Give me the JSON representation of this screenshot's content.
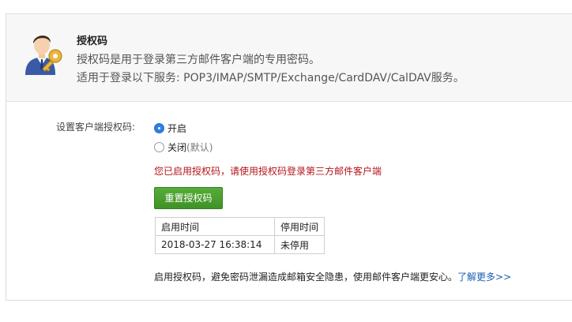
{
  "header": {
    "title": "授权码",
    "line1": "授权码是用于登录第三方邮件客户端的专用密码。",
    "line2": "适用于登录以下服务: POP3/IMAP/SMTP/Exchange/CardDAV/CalDAV服务。"
  },
  "setting": {
    "label": "设置客户端授权码:",
    "options": [
      {
        "label": "开启",
        "suffix": "",
        "checked": true
      },
      {
        "label": "关闭",
        "suffix": "(默认)",
        "checked": false
      }
    ],
    "warning": "您已启用授权码，请使用授权码登录第三方邮件客户端",
    "reset_button": "重置授权码"
  },
  "table": {
    "headers": [
      "启用时间",
      "停用时间"
    ],
    "rows": [
      [
        "2018-03-27 16:38:14",
        "未停用"
      ]
    ]
  },
  "footer": {
    "text": "启用授权码，避免密码泄漏造成邮箱安全隐患，使用邮件客户端更安心。",
    "link": "了解更多>>"
  },
  "colors": {
    "accent_blue": "#2e7fe0",
    "warning_red": "#b3151c",
    "button_green": "#4aa131",
    "link_blue": "#1b5fb6"
  },
  "icons": {
    "avatar": "user-with-key-icon"
  }
}
